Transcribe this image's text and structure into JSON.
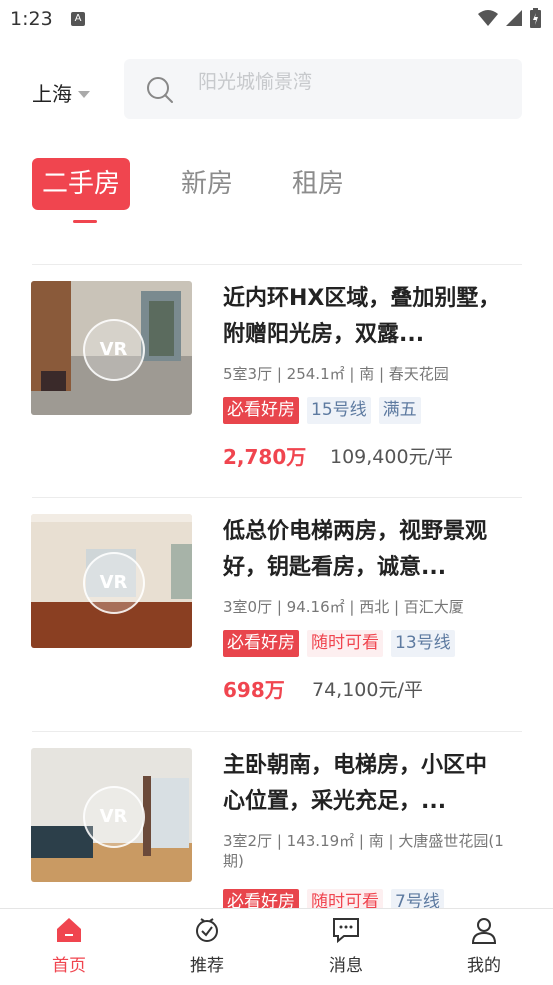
{
  "status_bar": {
    "time": "1:23"
  },
  "header": {
    "city": "上海",
    "search_placeholder": "阳光城愉景湾"
  },
  "tabs": [
    {
      "label": "二手房",
      "active": true
    },
    {
      "label": "新房",
      "active": false
    },
    {
      "label": "租房",
      "active": false
    }
  ],
  "listings": [
    {
      "title": "近内环HX区域，叠加别墅，附赠阳光房，双露...",
      "meta": "5室3厅 | 254.1㎡ | 南 | 春天花园",
      "tags": [
        {
          "text": "必看好房",
          "style": "red"
        },
        {
          "text": "15号线",
          "style": "blue"
        },
        {
          "text": "满五",
          "style": "blue"
        }
      ],
      "price": "2,780万",
      "unit_price": "109,400元/平",
      "vr_label": "VR"
    },
    {
      "title": "低总价电梯两房，视野景观好，钥匙看房，诚意...",
      "meta": "3室0厅 | 94.16㎡ | 西北 | 百汇大厦",
      "tags": [
        {
          "text": "必看好房",
          "style": "red"
        },
        {
          "text": "随时可看",
          "style": "pink"
        },
        {
          "text": "13号线",
          "style": "blue"
        }
      ],
      "price": "698万",
      "unit_price": "74,100元/平",
      "vr_label": "VR"
    },
    {
      "title": "主卧朝南，电梯房，小区中心位置，采光充足，...",
      "meta": "3室2厅 | 143.19㎡ | 南 | 大唐盛世花园(1期)",
      "tags": [
        {
          "text": "必看好房",
          "style": "red"
        },
        {
          "text": "随时可看",
          "style": "pink"
        },
        {
          "text": "7号线",
          "style": "blue"
        }
      ],
      "price": "",
      "unit_price": "",
      "vr_label": "VR"
    }
  ],
  "bottom_nav": [
    {
      "label": "首页",
      "icon": "home-icon",
      "active": true
    },
    {
      "label": "推荐",
      "icon": "recommend-icon",
      "active": false
    },
    {
      "label": "消息",
      "icon": "message-icon",
      "active": false
    },
    {
      "label": "我的",
      "icon": "profile-icon",
      "active": false
    }
  ],
  "colors": {
    "accent": "#f0454f",
    "tag_blue": "#5d7aa0"
  }
}
